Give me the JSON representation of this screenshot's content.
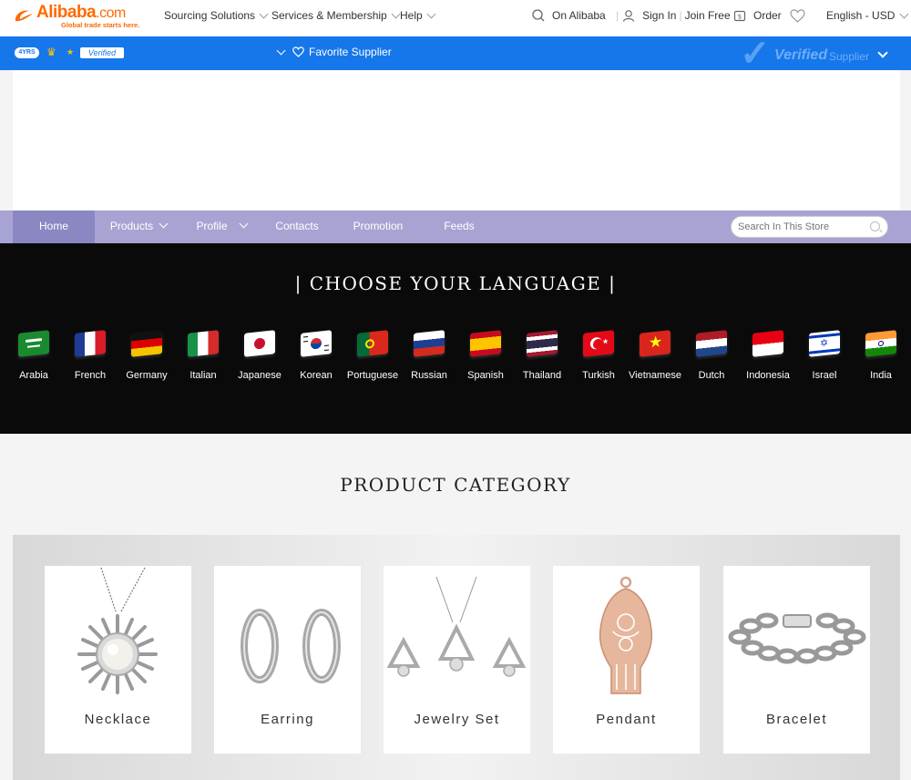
{
  "header": {
    "logo_text": "Alibaba",
    "logo_domain": ".com",
    "slogan": "Global trade starts here.",
    "nav": [
      "Sourcing Solutions",
      "Services & Membership",
      "Help"
    ],
    "on_alibaba": "On Alibaba",
    "sign_in": "Sign In",
    "join_free": "Join Free",
    "order": "Order",
    "language": "English - USD"
  },
  "supplier_bar": {
    "years": "4YRS",
    "verified_badge": "Verified",
    "favorite": "Favorite Supplier",
    "verified_big": "Verified",
    "supplier_word": "Supplier"
  },
  "store_nav": {
    "items": [
      "Home",
      "Products",
      "Profile",
      "Contacts",
      "Promotion",
      "Feeds"
    ],
    "search_placeholder": "Search In This Store"
  },
  "language_section": {
    "title": "| CHOOSE YOUR LANGUAGE |",
    "languages": [
      "Arabia",
      "French",
      "Germany",
      "Italian",
      "Japanese",
      "Korean",
      "Portuguese",
      "Russian",
      "Spanish",
      "Thailand",
      "Turkish",
      "Vietnamese",
      "Dutch",
      "Indonesia",
      "Israel",
      "India"
    ]
  },
  "product_category": {
    "title": "PRODUCT CATEGORY",
    "items": [
      "Necklace",
      "Earring",
      "Jewelry Set",
      "Pendant",
      "Bracelet"
    ]
  },
  "colors": {
    "brand_orange": "#ff6a00",
    "supplier_blue": "#1677ea",
    "store_nav": "#a7a4d3",
    "store_nav_active": "#8a87c2"
  }
}
